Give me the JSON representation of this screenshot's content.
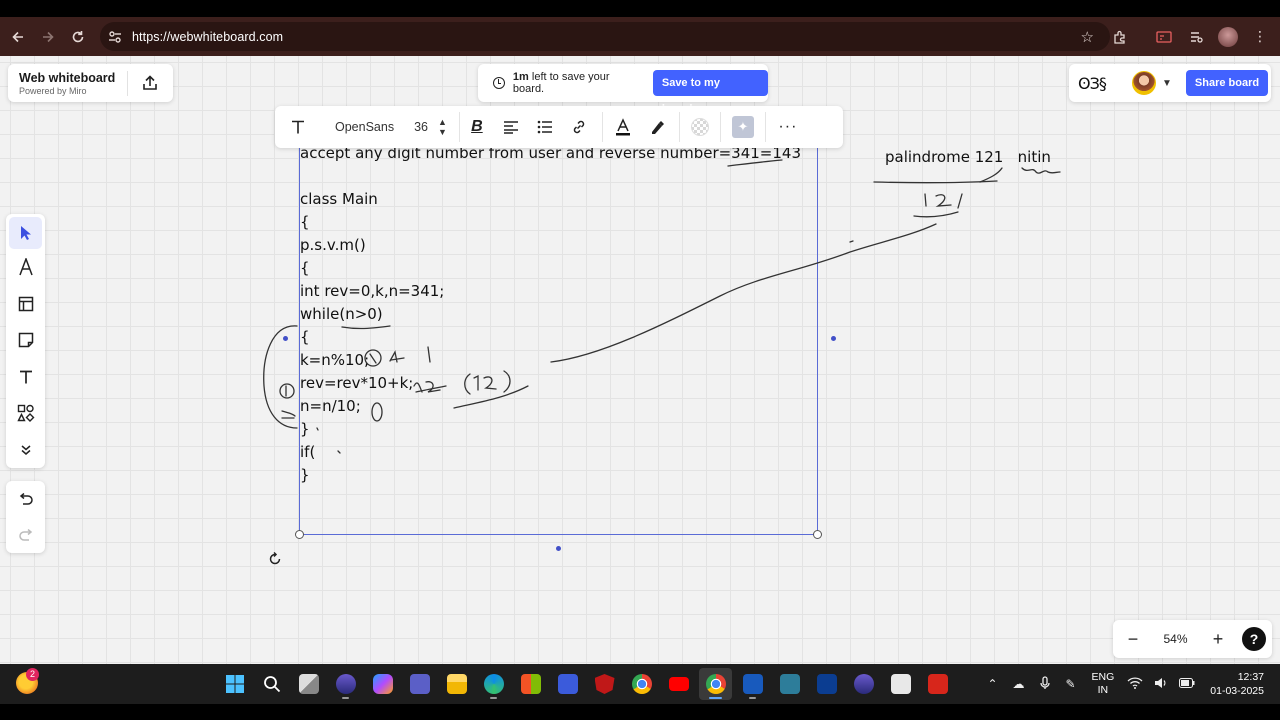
{
  "browser": {
    "url": "https://webwhiteboard.com"
  },
  "brand": {
    "name": "Web whiteboard",
    "subtitle": "Powered by Miro"
  },
  "notice": {
    "time": "1m",
    "text": " left to save your board.",
    "save_label": "Save to my boards"
  },
  "share": {
    "reactions": "ʘЗ§",
    "share_label": "Share board"
  },
  "textbar": {
    "font": "OpenSans",
    "size": "36"
  },
  "board": {
    "title_line": "accept any digit number from user and reverse number=341=143",
    "code_lines": [
      "class Main",
      "{",
      "p.s.v.m()",
      "{",
      "int rev=0,k,n=341;",
      "while(n>0)",
      "{",
      "k=n%10;",
      "rev=rev*10+k;",
      "n=n/10;",
      "}",
      "if(",
      "}"
    ],
    "palindrome_text": "palindrome 121",
    "nitin_text": "nitin"
  },
  "zoom": {
    "level": "54%",
    "minus": "−",
    "plus": "+",
    "help": "?"
  },
  "taskbar": {
    "weather_badge": "2",
    "lang_line1": "ENG",
    "lang_line2": "IN",
    "time": "12:37",
    "date": "01-03-2025"
  },
  "colors": {
    "accent": "#4262ff",
    "chrome": "#3c1f1c",
    "selection": "#5a6bd6"
  }
}
